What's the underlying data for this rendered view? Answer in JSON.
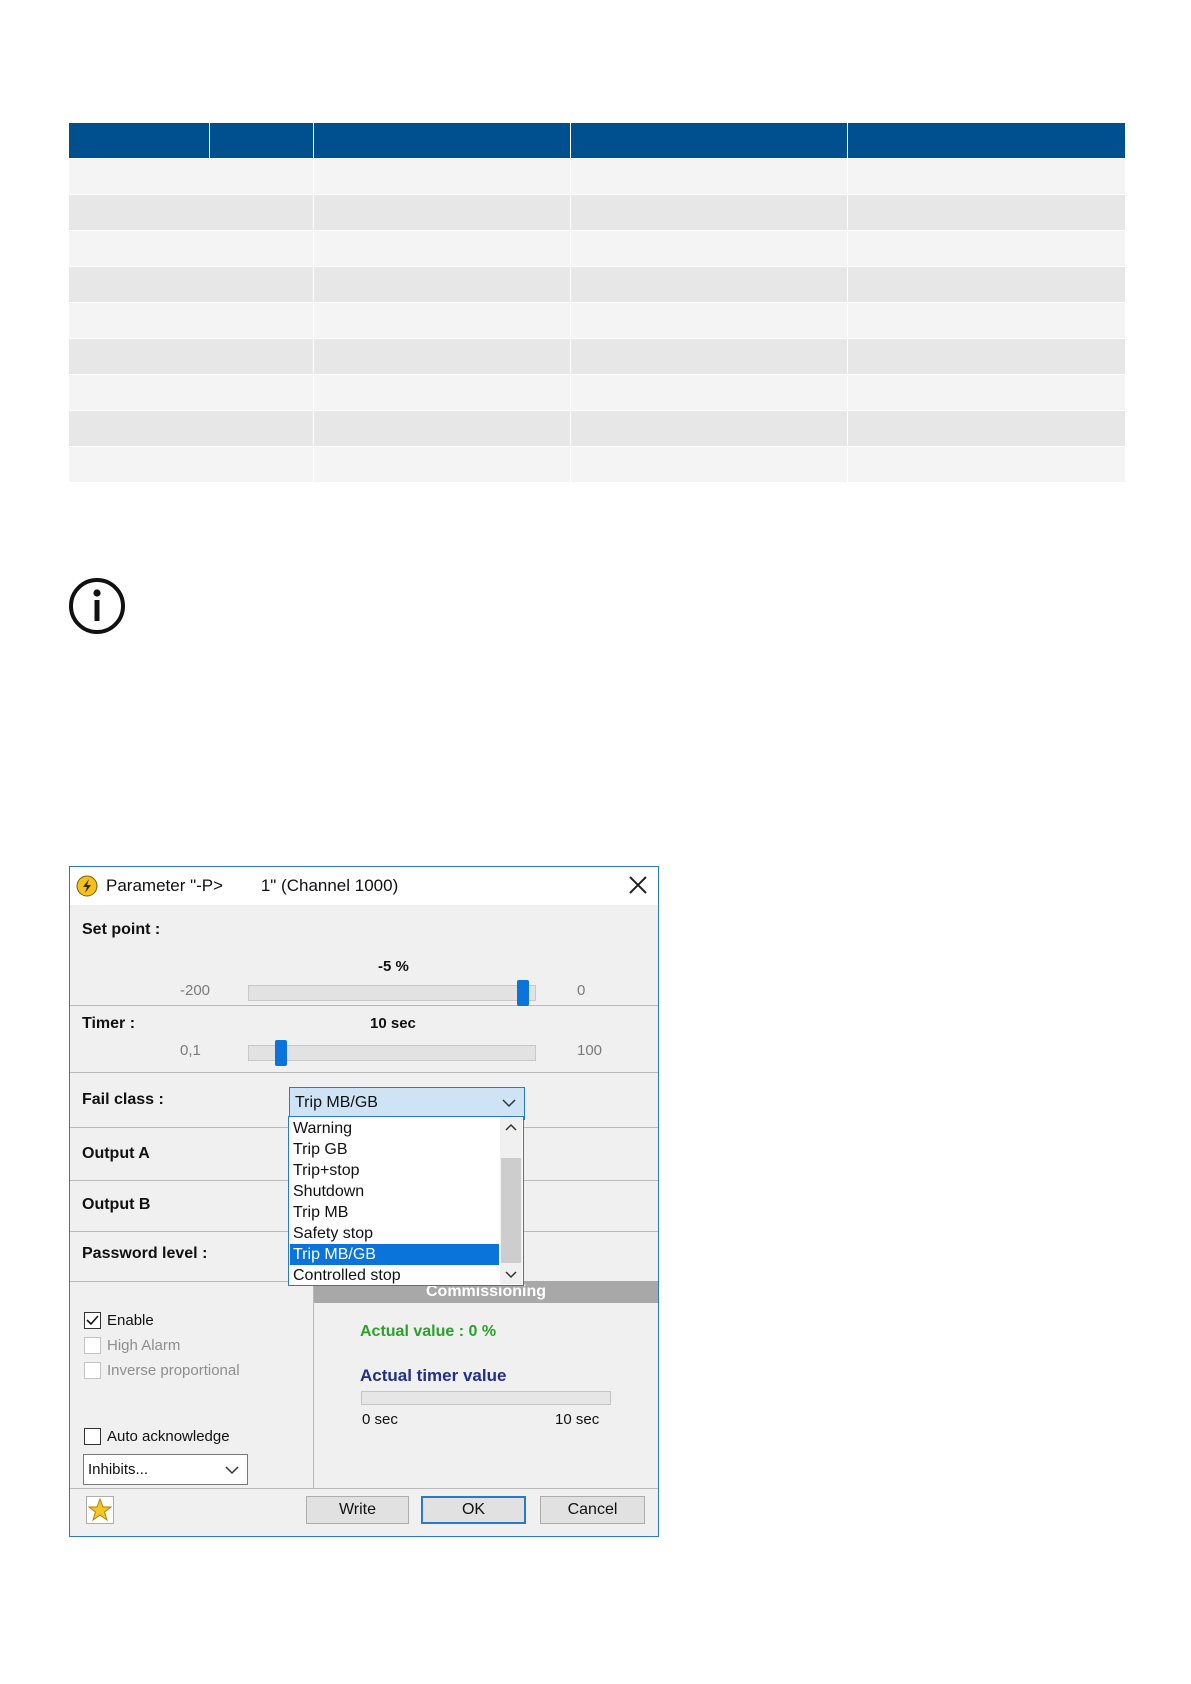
{
  "dialog": {
    "title": "Parameter \"-P>        1\" (Channel 1000)",
    "setpoint": {
      "label": "Set point :",
      "value_text": "-5 %",
      "min": "-200",
      "max": "0",
      "value": -5
    },
    "timer": {
      "label": "Timer :",
      "value_text": "10 sec",
      "min": "0,1",
      "max": "100",
      "value": 10
    },
    "fail_class": {
      "label": "Fail class :",
      "selected": "Trip MB/GB",
      "options": [
        "Warning",
        "Trip GB",
        "Trip+stop",
        "Shutdown",
        "Trip MB",
        "Safety stop",
        "Trip MB/GB",
        "Controlled stop"
      ]
    },
    "output_a": {
      "label": "Output A"
    },
    "output_b": {
      "label": "Output B"
    },
    "password": {
      "label": "Password level :"
    },
    "checks": {
      "enable": "Enable",
      "high_alarm": "High Alarm",
      "inverse": "Inverse proportional",
      "auto_ack": "Auto acknowledge"
    },
    "inhibits": "Inhibits...",
    "commissioning": {
      "header": "Commissioning",
      "actual_value": "Actual value : 0 %",
      "timer_title": "Actual timer value",
      "timer_min": "0 sec",
      "timer_max": "10 sec"
    },
    "buttons": {
      "write": "Write",
      "ok": "OK",
      "cancel": "Cancel"
    }
  }
}
